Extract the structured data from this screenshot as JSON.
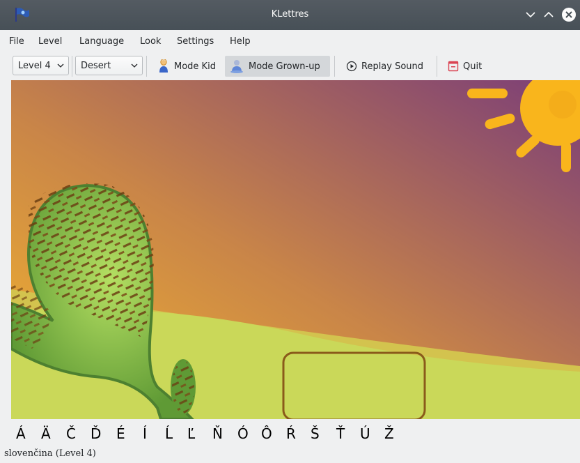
{
  "window": {
    "title": "KLettres"
  },
  "menu": [
    "File",
    "Level",
    "Language",
    "Look",
    "Settings",
    "Help"
  ],
  "toolbar": {
    "level": "Level 4",
    "theme": "Desert",
    "mode_kid": "Mode Kid",
    "mode_grownup": "Mode Grown-up",
    "replay": "Replay Sound",
    "quit": "Quit"
  },
  "colors": {
    "titlebar": "#475057",
    "sun": "#f9b51c",
    "cactus": "#6ea83c",
    "box_border": "#8a5a1a",
    "ground": "#c9d95a"
  },
  "letters": [
    "Á",
    "Ä",
    "Č",
    "Ď",
    "É",
    "Í",
    "Ĺ",
    "Ľ",
    "Ň",
    "Ó",
    "Ô",
    "Ŕ",
    "Š",
    "Ť",
    "Ú",
    "Ž"
  ],
  "status": "slovenčina  (Level 4)"
}
